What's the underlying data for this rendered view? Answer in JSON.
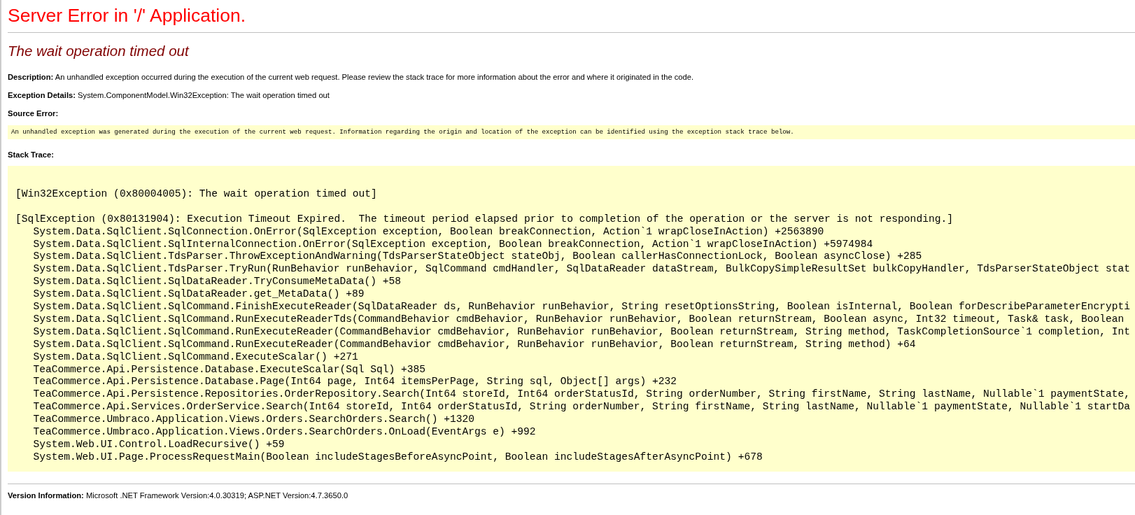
{
  "title": "Server Error in '/' Application.",
  "subtitle": "The wait operation timed out",
  "description": "**Description:** An unhandled exception occurred during the execution of the current web request. Please review the stack trace for more information about the error and where it originated in the code.",
  "exception_details": "**Exception Details:** System.ComponentModel.Win32Exception: The wait operation timed out",
  "source_error": {
    "heading": "Source Error:",
    "text": "An unhandled exception was generated during the execution of the current web request. Information regarding the origin and location of the exception can be identified using the exception stack trace below."
  },
  "stack_trace": {
    "heading": "Stack Trace:",
    "exceptions": [
      {
        "header": "[Win32Exception (0x80004005): The wait operation timed out]"
      },
      {
        "header": "[SqlException (0x80131904): Execution Timeout Expired.  The timeout period elapsed prior to completion of the operation or the server is not responding.]",
        "frames": [
          "System.Data.SqlClient.SqlConnection.OnError(SqlException exception, Boolean breakConnection, Action`1 wrapCloseInAction) +2563890",
          "System.Data.SqlClient.SqlInternalConnection.OnError(SqlException exception, Boolean breakConnection, Action`1 wrapCloseInAction) +5974984",
          "System.Data.SqlClient.TdsParser.ThrowExceptionAndWarning(TdsParserStateObject stateObj, Boolean callerHasConnectionLock, Boolean asyncClose) +285",
          "System.Data.SqlClient.TdsParser.TryRun(RunBehavior runBehavior, SqlCommand cmdHandler, SqlDataReader dataStream, BulkCopySimpleResultSet bulkCopyHandler, TdsParserStateObject stat",
          "System.Data.SqlClient.SqlDataReader.TryConsumeMetaData() +58",
          "System.Data.SqlClient.SqlDataReader.get_MetaData() +89",
          "System.Data.SqlClient.SqlCommand.FinishExecuteReader(SqlDataReader ds, RunBehavior runBehavior, String resetOptionsString, Boolean isInternal, Boolean forDescribeParameterEncrypti",
          "System.Data.SqlClient.SqlCommand.RunExecuteReaderTds(CommandBehavior cmdBehavior, RunBehavior runBehavior, Boolean returnStream, Boolean async, Int32 timeout, Task& task, Boolean",
          "System.Data.SqlClient.SqlCommand.RunExecuteReader(CommandBehavior cmdBehavior, RunBehavior runBehavior, Boolean returnStream, String method, TaskCompletionSource`1 completion, Int",
          "System.Data.SqlClient.SqlCommand.RunExecuteReader(CommandBehavior cmdBehavior, RunBehavior runBehavior, Boolean returnStream, String method) +64",
          "System.Data.SqlClient.SqlCommand.ExecuteScalar() +271",
          "TeaCommerce.Api.Persistence.Database.ExecuteScalar(Sql Sql) +385",
          "TeaCommerce.Api.Persistence.Database.Page(Int64 page, Int64 itemsPerPage, String sql, Object[] args) +232",
          "TeaCommerce.Api.Persistence.Repositories.OrderRepository.Search(Int64 storeId, Int64 orderStatusId, String orderNumber, String firstName, String lastName, Nullable`1 paymentState,",
          "TeaCommerce.Api.Services.OrderService.Search(Int64 storeId, Int64 orderStatusId, String orderNumber, String firstName, String lastName, Nullable`1 paymentState, Nullable`1 startDa",
          "TeaCommerce.Umbraco.Application.Views.Orders.SearchOrders.Search() +1320",
          "TeaCommerce.Umbraco.Application.Views.Orders.SearchOrders.OnLoad(EventArgs e) +992",
          "System.Web.UI.Control.LoadRecursive() +59",
          "System.Web.UI.Page.ProcessRequestMain(Boolean includeStagesBeforeAsyncPoint, Boolean includeStagesAfterAsyncPoint) +678"
        ]
      }
    ]
  },
  "version_information": "**Version Information:** Microsoft .NET Framework Version:4.0.30319; ASP.NET Version:4.7.3650.0"
}
